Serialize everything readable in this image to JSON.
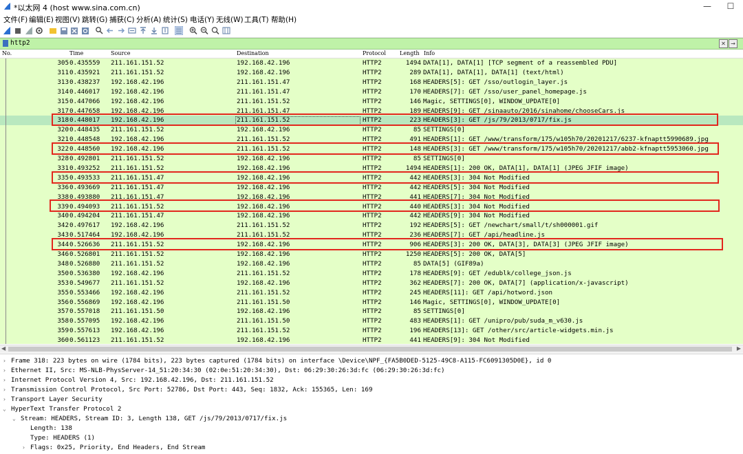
{
  "window": {
    "title": "*以太网 4 (host www.sina.com.cn)",
    "minimize": "—",
    "maximize": "☐"
  },
  "menu": [
    "文件(F)",
    "编辑(E)",
    "视图(V)",
    "跳转(G)",
    "捕获(C)",
    "分析(A)",
    "统计(S)",
    "电话(Y)",
    "无线(W)",
    "工具(T)",
    "帮助(H)"
  ],
  "filter": {
    "value": "http2",
    "clear": "✕",
    "apply": "→"
  },
  "columns": {
    "no": "No.",
    "time": "Time",
    "source": "Source",
    "destination": "Destination",
    "protocol": "Protocol",
    "length": "Length",
    "info": "Info"
  },
  "packets": [
    {
      "no": "305",
      "time": "0.435559",
      "src": "211.161.151.52",
      "dst": "192.168.42.196",
      "proto": "HTTP2",
      "len": "1494",
      "info": "DATA[1], DATA[1] [TCP segment of a reassembled PDU]"
    },
    {
      "no": "311",
      "time": "0.435921",
      "src": "211.161.151.52",
      "dst": "192.168.42.196",
      "proto": "HTTP2",
      "len": "289",
      "info": "DATA[1], DATA[1], DATA[1] (text/html)"
    },
    {
      "no": "313",
      "time": "0.438237",
      "src": "192.168.42.196",
      "dst": "211.161.151.47",
      "proto": "HTTP2",
      "len": "168",
      "info": "HEADERS[5]: GET /sso/outlogin_layer.js"
    },
    {
      "no": "314",
      "time": "0.446017",
      "src": "192.168.42.196",
      "dst": "211.161.151.47",
      "proto": "HTTP2",
      "len": "170",
      "info": "HEADERS[7]: GET /sso/user_panel_homepage.js"
    },
    {
      "no": "315",
      "time": "0.447066",
      "src": "192.168.42.196",
      "dst": "211.161.151.52",
      "proto": "HTTP2",
      "len": "146",
      "info": "Magic, SETTINGS[0], WINDOW_UPDATE[0]"
    },
    {
      "no": "317",
      "time": "0.447658",
      "src": "192.168.42.196",
      "dst": "211.161.151.47",
      "proto": "HTTP2",
      "len": "189",
      "info": "HEADERS[9]: GET /sinaauto/2016/sinahome/chooseCars.js"
    },
    {
      "no": "318",
      "time": "0.448017",
      "src": "192.168.42.196",
      "dst": "211.161.151.52",
      "proto": "HTTP2",
      "len": "223",
      "info": "HEADERS[3]: GET /js/79/2013/0717/fix.js",
      "selected": true
    },
    {
      "no": "320",
      "time": "0.448435",
      "src": "211.161.151.52",
      "dst": "192.168.42.196",
      "proto": "HTTP2",
      "len": "85",
      "info": "SETTINGS[0]"
    },
    {
      "no": "321",
      "time": "0.448548",
      "src": "192.168.42.196",
      "dst": "211.161.151.52",
      "proto": "HTTP2",
      "len": "491",
      "info": "HEADERS[1]: GET /www/transform/175/w105h70/20201217/6237-kfnaptt5990689.jpg"
    },
    {
      "no": "322",
      "time": "0.448560",
      "src": "192.168.42.196",
      "dst": "211.161.151.52",
      "proto": "HTTP2",
      "len": "148",
      "info": "HEADERS[3]: GET /www/transform/175/w105h70/20201217/abb2-kfnaptt5953060.jpg"
    },
    {
      "no": "328",
      "time": "0.492801",
      "src": "211.161.151.52",
      "dst": "192.168.42.196",
      "proto": "HTTP2",
      "len": "85",
      "info": "SETTINGS[0]"
    },
    {
      "no": "331",
      "time": "0.493252",
      "src": "211.161.151.52",
      "dst": "192.168.42.196",
      "proto": "HTTP2",
      "len": "1494",
      "info": "HEADERS[1]: 200 OK, DATA[1], DATA[1] (JPEG JFIF image)"
    },
    {
      "no": "335",
      "time": "0.493533",
      "src": "211.161.151.47",
      "dst": "192.168.42.196",
      "proto": "HTTP2",
      "len": "442",
      "info": "HEADERS[3]: 304 Not Modified"
    },
    {
      "no": "336",
      "time": "0.493669",
      "src": "211.161.151.47",
      "dst": "192.168.42.196",
      "proto": "HTTP2",
      "len": "442",
      "info": "HEADERS[5]: 304 Not Modified"
    },
    {
      "no": "338",
      "time": "0.493880",
      "src": "211.161.151.47",
      "dst": "192.168.42.196",
      "proto": "HTTP2",
      "len": "441",
      "info": "HEADERS[7]: 304 Not Modified"
    },
    {
      "no": "339",
      "time": "0.494093",
      "src": "211.161.151.52",
      "dst": "192.168.42.196",
      "proto": "HTTP2",
      "len": "440",
      "info": "HEADERS[3]: 304 Not Modified"
    },
    {
      "no": "340",
      "time": "0.494204",
      "src": "211.161.151.47",
      "dst": "192.168.42.196",
      "proto": "HTTP2",
      "len": "442",
      "info": "HEADERS[9]: 304 Not Modified"
    },
    {
      "no": "342",
      "time": "0.497617",
      "src": "192.168.42.196",
      "dst": "211.161.151.52",
      "proto": "HTTP2",
      "len": "192",
      "info": "HEADERS[5]: GET /newchart/small/t/sh000001.gif"
    },
    {
      "no": "343",
      "time": "0.517464",
      "src": "192.168.42.196",
      "dst": "211.161.151.52",
      "proto": "HTTP2",
      "len": "236",
      "info": "HEADERS[7]: GET /api/headline.js"
    },
    {
      "no": "344",
      "time": "0.526636",
      "src": "211.161.151.52",
      "dst": "192.168.42.196",
      "proto": "HTTP2",
      "len": "906",
      "info": "HEADERS[3]: 200 OK, DATA[3], DATA[3] (JPEG JFIF image)"
    },
    {
      "no": "346",
      "time": "0.526801",
      "src": "211.161.151.52",
      "dst": "192.168.42.196",
      "proto": "HTTP2",
      "len": "1250",
      "info": "HEADERS[5]: 200 OK, DATA[5]"
    },
    {
      "no": "348",
      "time": "0.526880",
      "src": "211.161.151.52",
      "dst": "192.168.42.196",
      "proto": "HTTP2",
      "len": "85",
      "info": "DATA[5] (GIF89a)"
    },
    {
      "no": "350",
      "time": "0.536380",
      "src": "192.168.42.196",
      "dst": "211.161.151.52",
      "proto": "HTTP2",
      "len": "178",
      "info": "HEADERS[9]: GET /edublk/college_json.js"
    },
    {
      "no": "353",
      "time": "0.549677",
      "src": "211.161.151.52",
      "dst": "192.168.42.196",
      "proto": "HTTP2",
      "len": "362",
      "info": "HEADERS[7]: 200 OK, DATA[7] (application/x-javascript)"
    },
    {
      "no": "355",
      "time": "0.553466",
      "src": "192.168.42.196",
      "dst": "211.161.151.52",
      "proto": "HTTP2",
      "len": "245",
      "info": "HEADERS[11]: GET /api/hotword.json"
    },
    {
      "no": "356",
      "time": "0.556869",
      "src": "192.168.42.196",
      "dst": "211.161.151.50",
      "proto": "HTTP2",
      "len": "146",
      "info": "Magic, SETTINGS[0], WINDOW_UPDATE[0]"
    },
    {
      "no": "357",
      "time": "0.557018",
      "src": "211.161.151.50",
      "dst": "192.168.42.196",
      "proto": "HTTP2",
      "len": "85",
      "info": "SETTINGS[0]"
    },
    {
      "no": "358",
      "time": "0.557095",
      "src": "192.168.42.196",
      "dst": "211.161.151.50",
      "proto": "HTTP2",
      "len": "483",
      "info": "HEADERS[1]: GET /unipro/pub/suda_m_v630.js"
    },
    {
      "no": "359",
      "time": "0.557613",
      "src": "192.168.42.196",
      "dst": "211.161.151.52",
      "proto": "HTTP2",
      "len": "196",
      "info": "HEADERS[13]: GET /other/src/article-widgets.min.js"
    },
    {
      "no": "360",
      "time": "0.561123",
      "src": "211.161.151.52",
      "dst": "192.168.42.196",
      "proto": "HTTP2",
      "len": "441",
      "info": "HEADERS[9]: 304 Not Modified"
    }
  ],
  "details": [
    {
      "arrow": ">",
      "indent": 0,
      "text": "Frame 318: 223 bytes on wire (1784 bits), 223 bytes captured (1784 bits) on interface \\Device\\NPF_{FA5B0DED-5125-49C8-A115-FC6091305D0E}, id 0"
    },
    {
      "arrow": ">",
      "indent": 0,
      "text": "Ethernet II, Src: MS-NLB-PhysServer-14_51:20:34:30 (02:0e:51:20:34:30), Dst: 06:29:30:26:3d:fc (06:29:30:26:3d:fc)"
    },
    {
      "arrow": ">",
      "indent": 0,
      "text": "Internet Protocol Version 4, Src: 192.168.42.196, Dst: 211.161.151.52"
    },
    {
      "arrow": ">",
      "indent": 0,
      "text": "Transmission Control Protocol, Src Port: 52786, Dst Port: 443, Seq: 1832, Ack: 155365, Len: 169"
    },
    {
      "arrow": ">",
      "indent": 0,
      "text": "Transport Layer Security"
    },
    {
      "arrow": "v",
      "indent": 0,
      "text": "HyperText Transfer Protocol 2"
    },
    {
      "arrow": "v",
      "indent": 1,
      "text": "Stream: HEADERS, Stream ID: 3, Length 138, GET /js/79/2013/0717/fix.js"
    },
    {
      "arrow": "",
      "indent": 2,
      "text": "Length: 138"
    },
    {
      "arrow": "",
      "indent": 2,
      "text": "Type: HEADERS (1)"
    },
    {
      "arrow": ">",
      "indent": 2,
      "text": "Flags: 0x25, Priority, End Headers, End Stream"
    }
  ]
}
